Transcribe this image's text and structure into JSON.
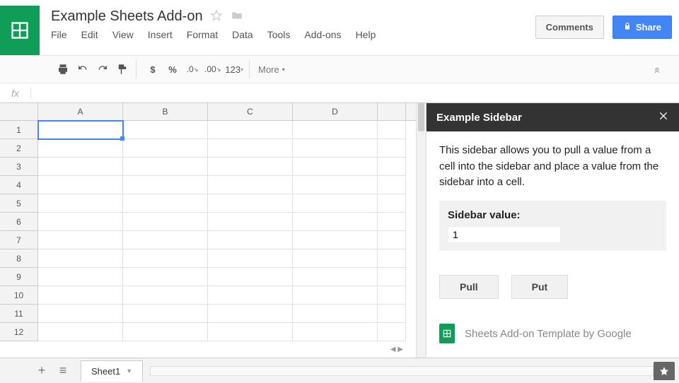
{
  "doc": {
    "title": "Example Sheets Add-on"
  },
  "menu": {
    "file": "File",
    "edit": "Edit",
    "view": "View",
    "insert": "Insert",
    "format": "Format",
    "data": "Data",
    "tools": "Tools",
    "addons": "Add-ons",
    "help": "Help"
  },
  "actions": {
    "comments": "Comments",
    "share": "Share"
  },
  "toolbar": {
    "currency": "$",
    "percent": "%",
    "dec_dec": ".0",
    "dec_inc": ".00",
    "num_format": "123",
    "more": "More"
  },
  "grid": {
    "columns": [
      "A",
      "B",
      "C",
      "D",
      ""
    ],
    "rows": [
      "1",
      "2",
      "3",
      "4",
      "5",
      "6",
      "7",
      "8",
      "9",
      "10",
      "11",
      "12"
    ],
    "selected": "A1"
  },
  "sidebar": {
    "title": "Example Sidebar",
    "desc": "This sidebar allows you to pull a value from a cell into the sidebar and place a value from the sidebar into a cell.",
    "value_label": "Sidebar value:",
    "value": "1",
    "pull": "Pull",
    "put": "Put",
    "footer": "Sheets Add-on Template by Google"
  },
  "sheet_tab": "Sheet1",
  "formula_label": "fx"
}
